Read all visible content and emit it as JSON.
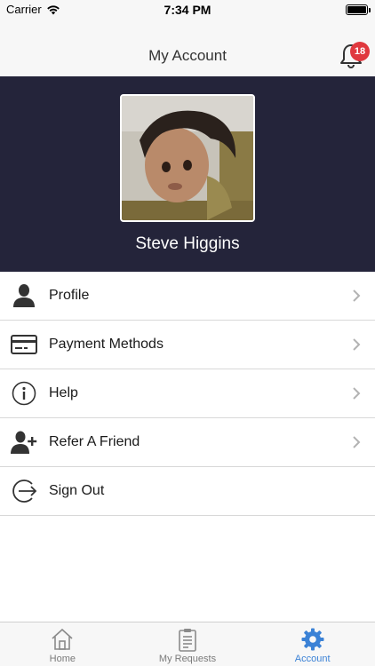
{
  "status_bar": {
    "carrier": "Carrier",
    "time": "7:34 PM"
  },
  "nav": {
    "title": "My Account",
    "notification_count": "18",
    "bell_icon": "bell-icon"
  },
  "profile": {
    "name": "Steve Higgins",
    "avatar": "profile-photo"
  },
  "menu": {
    "items": [
      {
        "label": "Profile",
        "icon": "person-icon",
        "has_chevron": true
      },
      {
        "label": "Payment Methods",
        "icon": "credit-card-icon",
        "has_chevron": true
      },
      {
        "label": "Help",
        "icon": "info-icon",
        "has_chevron": true
      },
      {
        "label": "Refer A Friend",
        "icon": "add-user-icon",
        "has_chevron": true
      },
      {
        "label": "Sign Out",
        "icon": "sign-out-icon",
        "has_chevron": false
      }
    ]
  },
  "tabs": {
    "items": [
      {
        "label": "Home",
        "icon": "home-icon"
      },
      {
        "label": "My Requests",
        "icon": "clipboard-icon"
      },
      {
        "label": "Account",
        "icon": "gear-icon"
      }
    ],
    "active": "Account"
  },
  "colors": {
    "header_bg": "#24243a",
    "accent": "#3b82d6",
    "badge": "#e0383e"
  }
}
